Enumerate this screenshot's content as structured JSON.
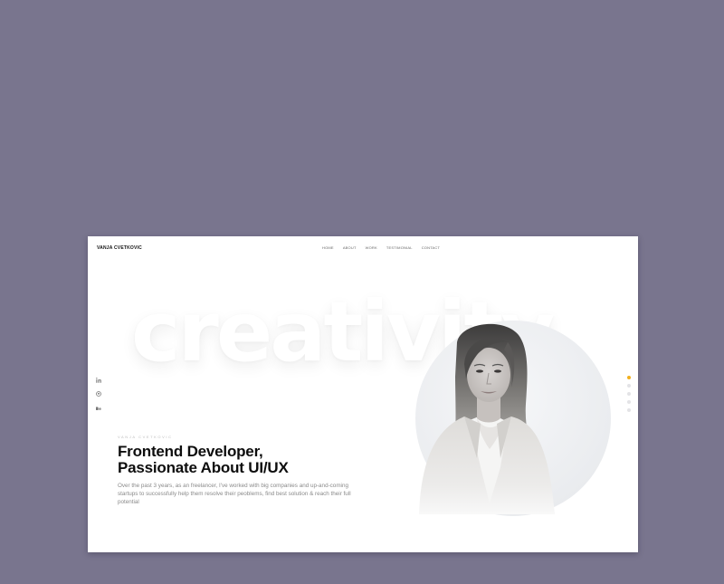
{
  "header": {
    "brand": "VANJA CVETKOVIC",
    "nav": [
      "HOME",
      "ABOUT",
      "WORK",
      "TESTIMONIAL",
      "CONTACT"
    ]
  },
  "hero": {
    "background_word": "creativity",
    "eyebrow": "VANJA CVETKOVIC",
    "headline_line1": "Frontend Developer,",
    "headline_line2": "Passionate About UI/UX",
    "description": "Over the past 3 years, as an freelancer, I've worked with big companies and up-and-coming startups to successfully help them resolve their peoblems, find best solution & reach their full potential"
  },
  "social": [
    "linkedin-icon",
    "github-icon",
    "behance-icon"
  ],
  "pagination": {
    "count": 5,
    "active_index": 0,
    "active_color": "#f2b01e"
  },
  "colors": {
    "backdrop": "#79758e",
    "page": "#ffffff",
    "heading": "#0d0d0d",
    "body_text": "#8a8a8a"
  }
}
